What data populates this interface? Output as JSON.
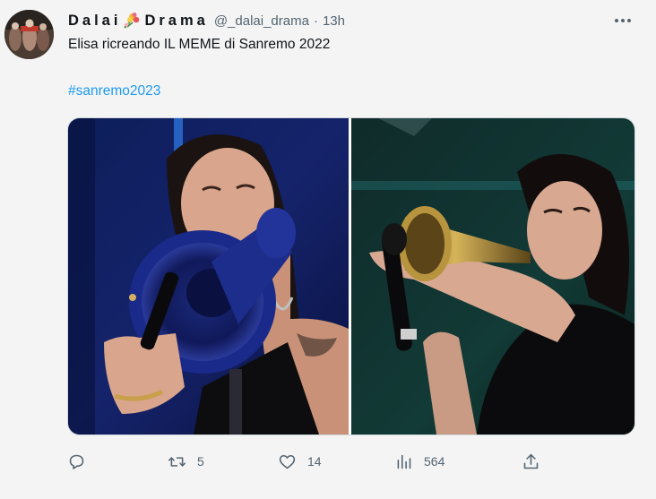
{
  "tweet": {
    "display_name": "Dalai",
    "display_name_2": "Drama",
    "handle": "@_dalai_drama",
    "separator": "·",
    "time": "13h",
    "text": "Elisa ricreando IL MEME di Sanremo 2022",
    "hashtag": "#sanremo2023"
  },
  "actions": {
    "reply_count": "",
    "retweet_count": "5",
    "like_count": "14",
    "views_count": "564"
  },
  "colors": {
    "link": "#1d9bf0",
    "muted": "#536471",
    "background": "#f4f4f4"
  },
  "icons": [
    "more-icon",
    "reply-icon",
    "retweet-icon",
    "like-icon",
    "views-icon",
    "share-icon",
    "flower-emoji-icon"
  ]
}
